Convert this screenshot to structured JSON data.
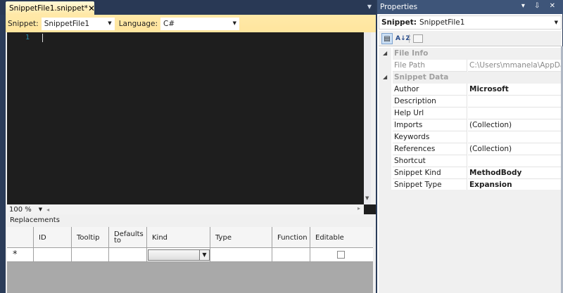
{
  "document": {
    "tab_title": "SnippetFile1.snippet*",
    "tab_close": "✕",
    "snippet_label": "Snippet:",
    "snippet_value": "SnippetFile1",
    "language_label": "Language:",
    "language_value": "C#",
    "line_number": "1",
    "zoom": "100 %",
    "replacements_label": "Replacements",
    "columns": [
      "ID",
      "Tooltip",
      "Defaults to",
      "Kind",
      "Type",
      "Function",
      "Editable"
    ],
    "new_row_marker": "*"
  },
  "properties": {
    "title": "Properties",
    "title_buttons": "▾ ⇩ ✕",
    "object_label": "Snippet:",
    "object_value": "SnippetFile1",
    "toolbar_alpha": "A↓Z",
    "categories": [
      {
        "name": "File Info",
        "rows": [
          {
            "name": "File Path",
            "value": "C:\\Users\\mmanela\\AppData"
          }
        ]
      },
      {
        "name": "Snippet Data",
        "rows": [
          {
            "name": "Author",
            "value": "Microsoft"
          },
          {
            "name": "Description",
            "value": ""
          },
          {
            "name": "Help Url",
            "value": ""
          },
          {
            "name": "Imports",
            "value": "(Collection)"
          },
          {
            "name": "Keywords",
            "value": ""
          },
          {
            "name": "References",
            "value": "(Collection)"
          },
          {
            "name": "Shortcut",
            "value": ""
          },
          {
            "name": "Snippet Kind",
            "value": "MethodBody"
          },
          {
            "name": "Snippet Type",
            "value": "Expansion"
          }
        ]
      }
    ]
  },
  "colors": {
    "accent_tab": "#ffe8a6",
    "chrome": "#293955",
    "editor_bg": "#1e1e1e"
  }
}
